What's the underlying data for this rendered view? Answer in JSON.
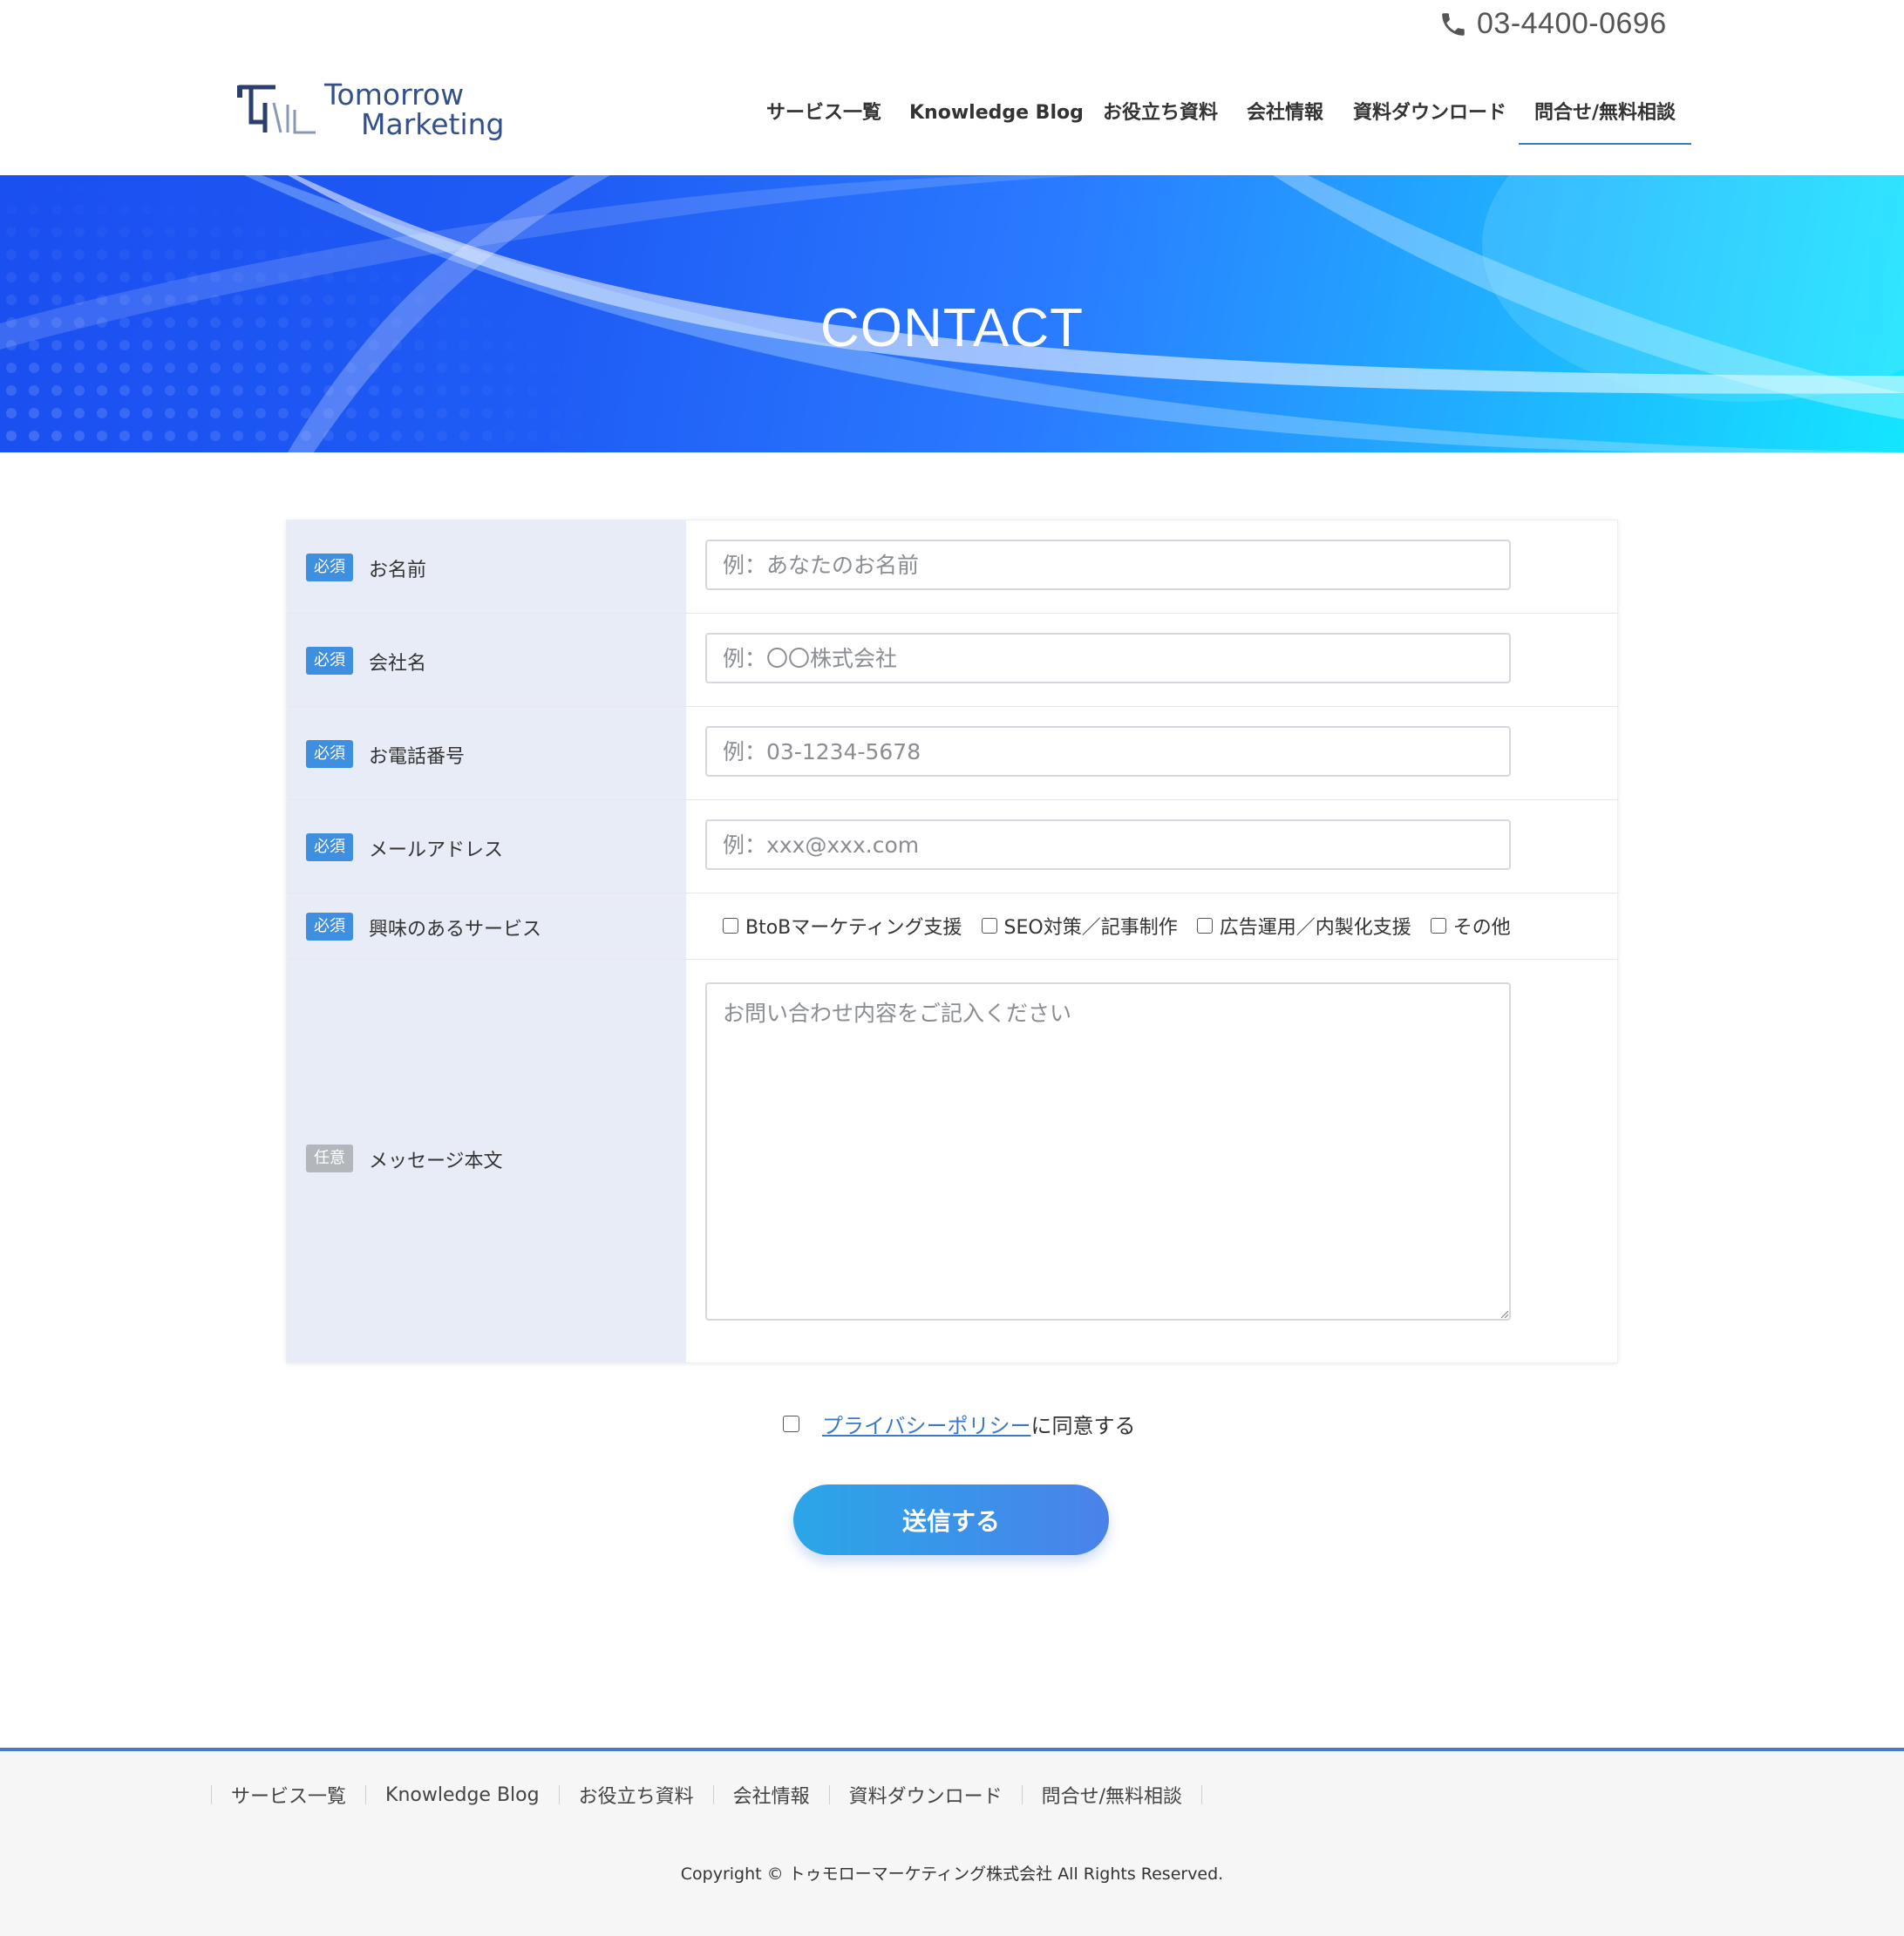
{
  "header": {
    "phone": "03-4400-0696",
    "logo_line1": "Tomorrow",
    "logo_line2": "Marketing",
    "nav": [
      {
        "label": "サービス一覧"
      },
      {
        "label": "Knowledge Blog"
      },
      {
        "label": "お役立ち資料"
      },
      {
        "label": "会社情報"
      },
      {
        "label": "資料ダウンロード"
      },
      {
        "label": "問合せ/無料相談",
        "active": true
      }
    ]
  },
  "hero": {
    "title": "CONTACT"
  },
  "form": {
    "badge_required": "必須",
    "badge_optional": "任意",
    "rows": [
      {
        "label": "お名前",
        "placeholder": "例：あなたのお名前",
        "value": ""
      },
      {
        "label": "会社名",
        "placeholder": "例：〇〇株式会社",
        "value": ""
      },
      {
        "label": "お電話番号",
        "placeholder": "例：03-1234-5678",
        "value": ""
      },
      {
        "label": "メールアドレス",
        "placeholder": "例：xxx@xxx.com",
        "value": ""
      },
      {
        "label": "興味のあるサービス",
        "options": [
          "BtoBマーケティング支援",
          "SEO対策／記事制作",
          "広告運用／内製化支援",
          "その他"
        ]
      },
      {
        "label": "メッセージ本文",
        "placeholder": "お問い合わせ内容をご記入ください",
        "value": ""
      }
    ]
  },
  "agree": {
    "link": "プライバシーポリシー",
    "suffix": "に同意する",
    "checked": false
  },
  "submit_label": "送信する",
  "footer": {
    "nav": [
      "サービス一覧",
      "Knowledge Blog",
      "お役立ち資料",
      "会社情報",
      "資料ダウンロード",
      "問合せ/無料相談"
    ],
    "copyright": "Copyright © トゥモローマーケティング株式会社 All Rights Reserved."
  },
  "colors": {
    "accent": "#3a78c8",
    "badge_required": "#3f8fe0",
    "badge_optional": "#b3b6bb",
    "label_column": "#e8ecf6",
    "logo": "#33508a"
  }
}
